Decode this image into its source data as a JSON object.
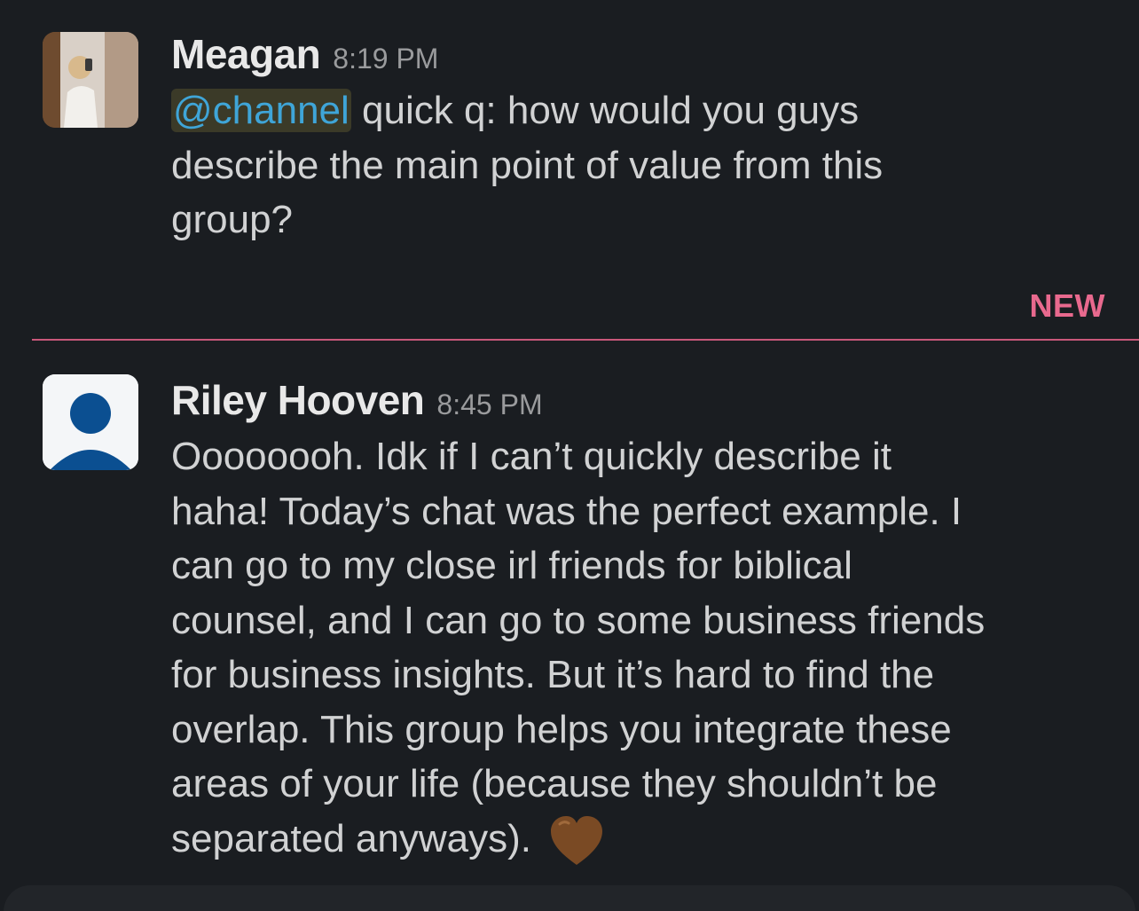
{
  "messages": [
    {
      "author": "Meagan",
      "time": "8:19 PM",
      "mention": "@channel",
      "text": " quick q: how would you guys\ndescribe the main point of value from this\ngroup?"
    },
    {
      "author": "Riley Hooven",
      "time": "8:45 PM",
      "text": "Oooooooh. Idk if I can’t quickly describe it\nhaha! Today’s chat was the perfect example. I\ncan go to my close irl friends for biblical\ncounsel, and I can go to some business friends\nfor business insights. But it’s hard to find the\noverlap. This group helps you integrate these\nareas of your life (because they shouldn’t be\nseparated anyways). ",
      "emoji": "brown-heart"
    }
  ],
  "divider": {
    "label": "NEW",
    "color": "#e8698e"
  },
  "colors": {
    "background": "#1a1d21",
    "mention_text": "#3fa5d8",
    "mention_bg": "#3b3a28",
    "avatar_default": "#0b4f91"
  }
}
